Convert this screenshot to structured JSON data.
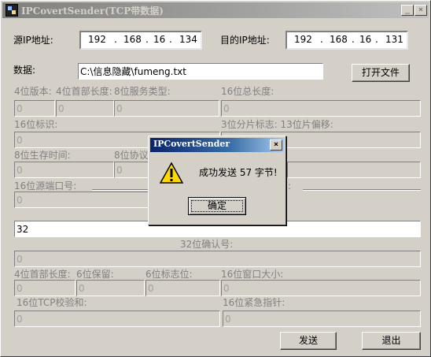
{
  "window": {
    "title": "IPCovertSender(TCP带数据)",
    "minimize_glyph": "_",
    "close_glyph": "×"
  },
  "ip": {
    "src_label": "源IP地址:",
    "src_octets": [
      "192",
      "168",
      "16",
      "134"
    ],
    "dst_label": "目的IP地址:",
    "dst_octets": [
      "192",
      "168",
      "16",
      "131"
    ],
    "dot": "."
  },
  "data": {
    "label": "数据:",
    "file_path": "C:\\信息隐藏\\fumeng.txt",
    "open_file_button": "打开文件"
  },
  "ip_header": {
    "version_label": "4位版本:",
    "version_value": "0",
    "header_len_label": "4位首部长度:",
    "header_len_value": "0",
    "tos_label": "8位服务类型:",
    "tos_value": "0",
    "total_len_label": "16位总长度:",
    "total_len_value": "0",
    "ident_label": "16位标识:",
    "ident_value": "0",
    "frag_label": "3位分片标志: 13位片偏移:",
    "frag_value": "0",
    "ttl_label": "8位生存时间:",
    "ttl_value": "0",
    "protocol_label": "8位协议",
    "protocol_value": "0"
  },
  "tcp_header": {
    "src_port_label": "16位源端口号:",
    "src_port_value": "0",
    "dst_port_trailing": ":",
    "seq_value": "32",
    "ack_label": "32位确认号:",
    "ack_value": "0",
    "header_len_label": "4位首部长度:",
    "header_len_value": "0",
    "reserved_label": "6位保留:",
    "reserved_value": "0",
    "flags_label": "6位标志位:",
    "flags_value": "0",
    "window_label": "16位窗口大小:",
    "window_value": "0",
    "checksum_label": "16位TCP校验和:",
    "checksum_value": "0",
    "urgent_label": "16位紧急指针:",
    "urgent_value": "0"
  },
  "buttons": {
    "send": "发送",
    "exit": "退出"
  },
  "dialog": {
    "title": "IPCovertSender",
    "message": "成功发送 57 字节!",
    "ok": "确定",
    "close_glyph": "×",
    "icon": "warning-icon"
  }
}
